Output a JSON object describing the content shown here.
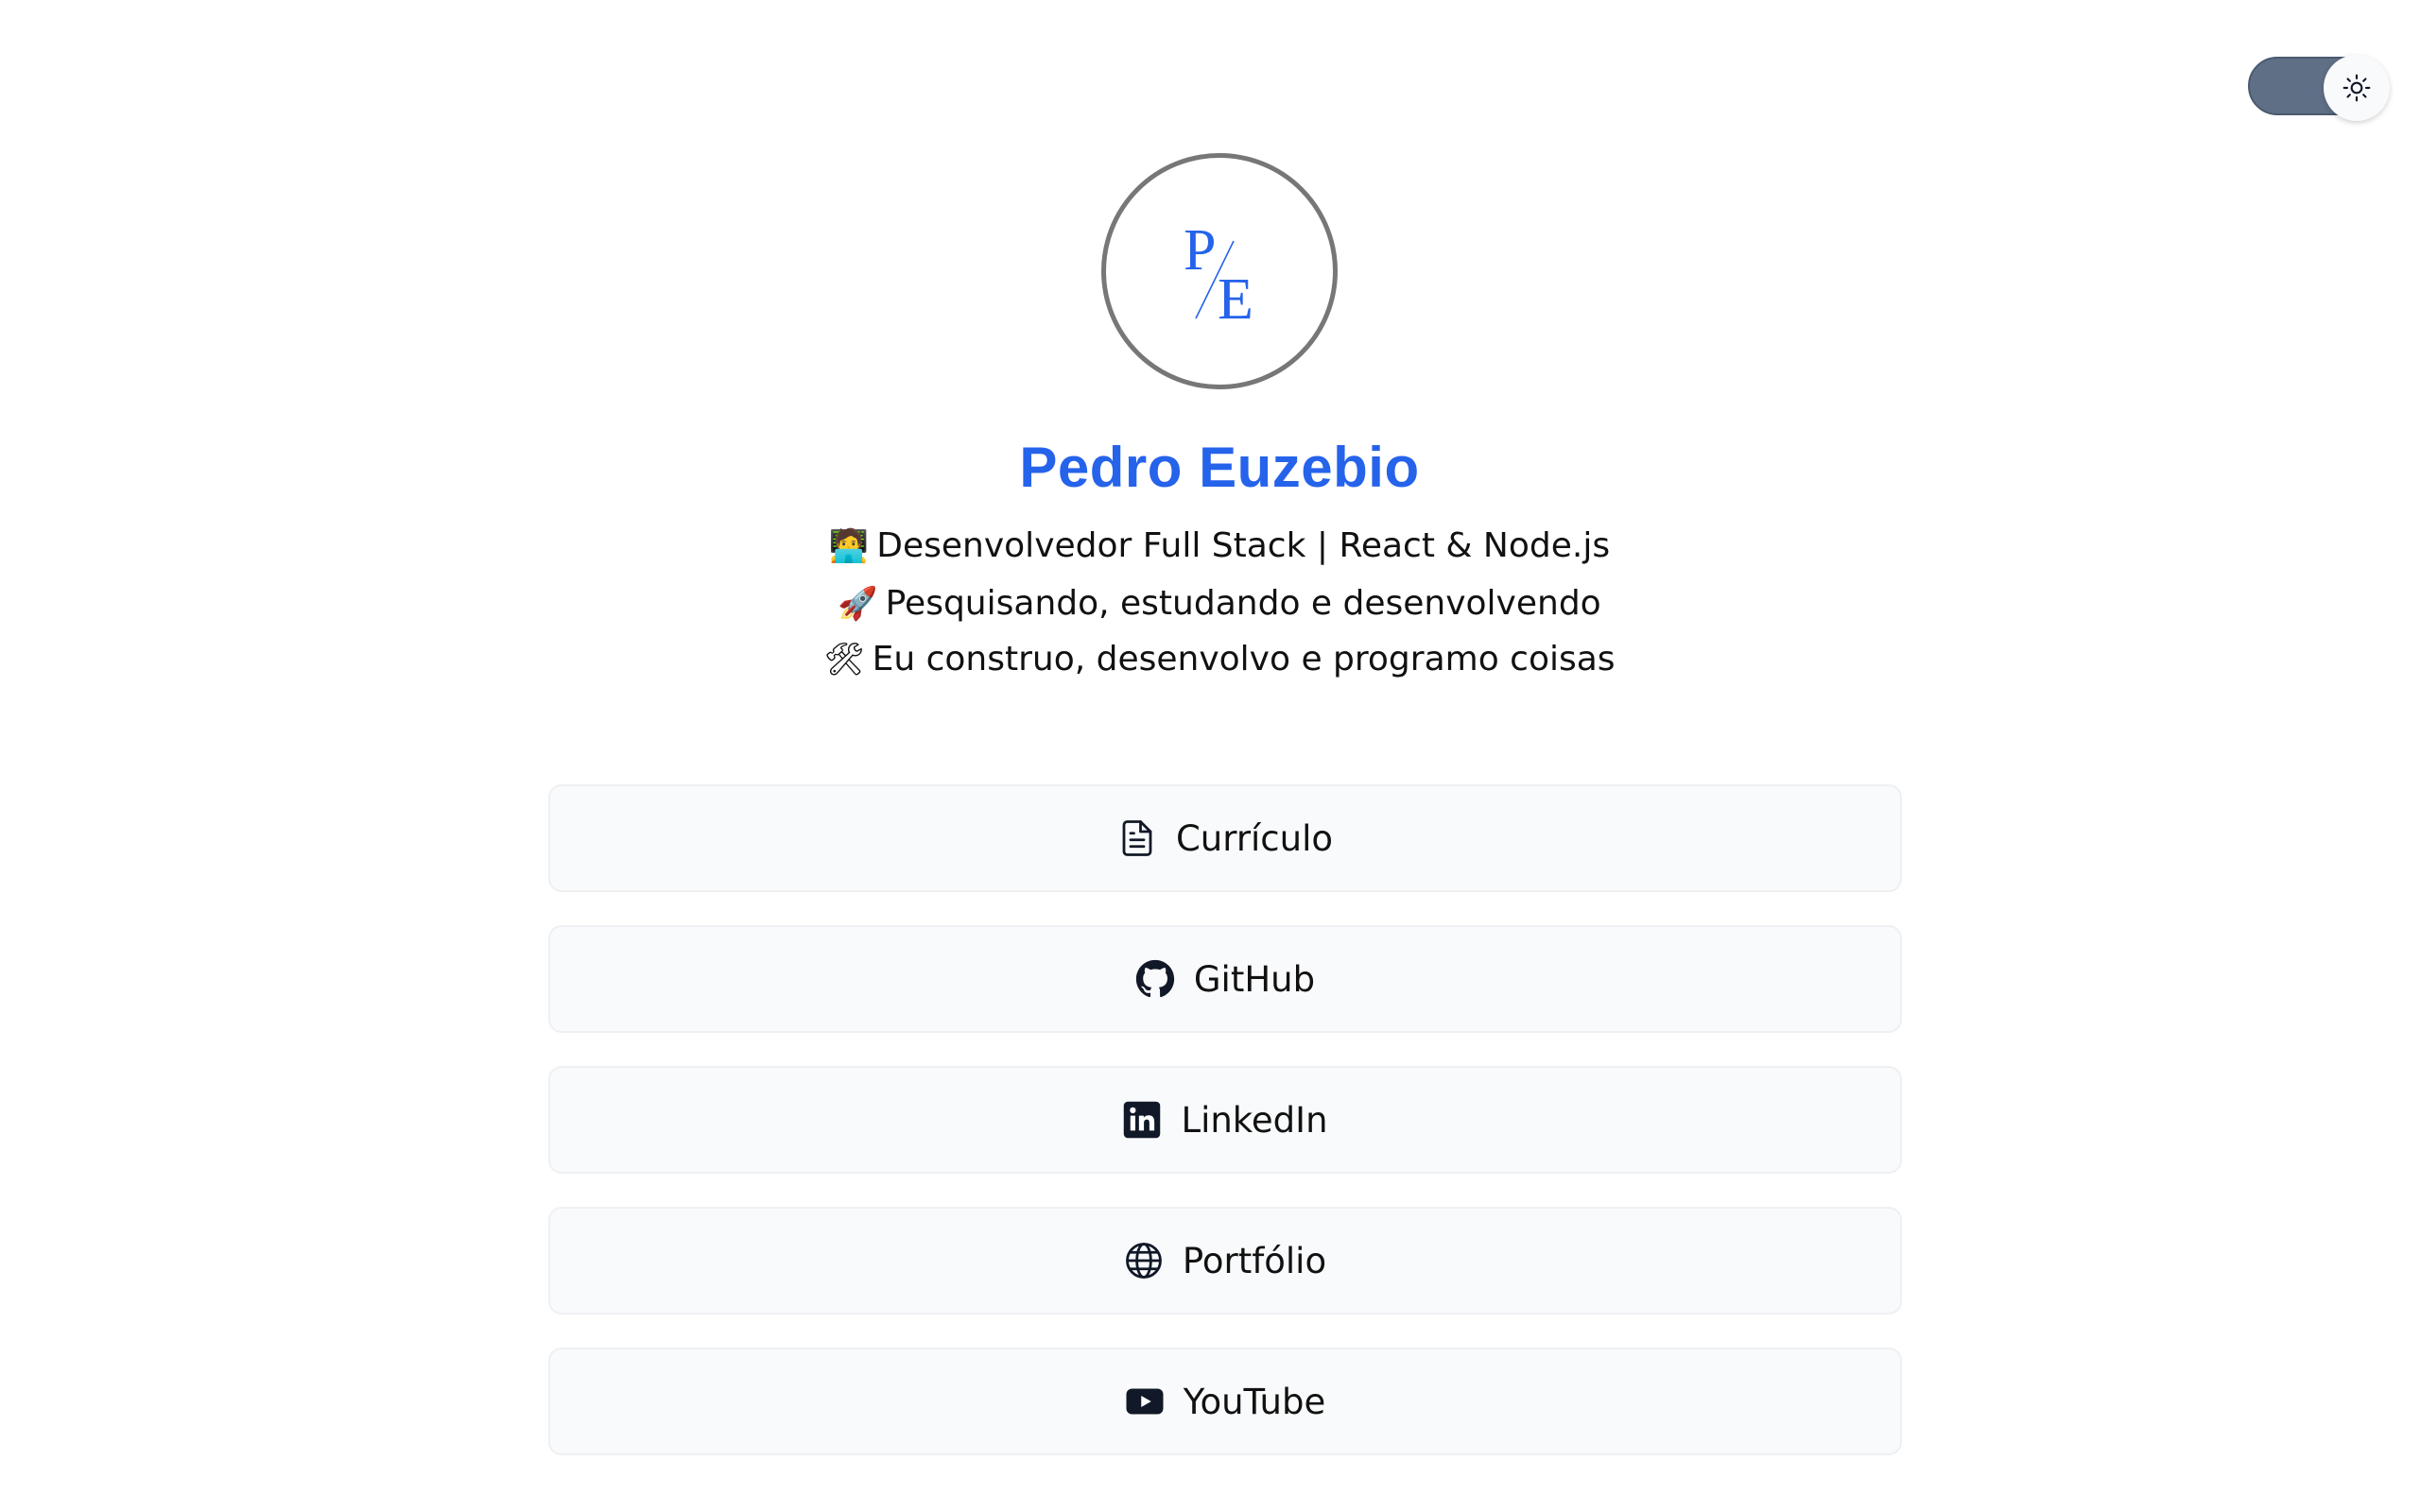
{
  "theme_toggle": {
    "icon": "sun-icon",
    "state": "light"
  },
  "profile": {
    "avatar_monogram": {
      "top": "P",
      "bottom": "E"
    },
    "name": "Pedro Euzebio",
    "bio": [
      {
        "emoji": "🧑‍💻",
        "text": "Desenvolvedor Full Stack | React & Node.js"
      },
      {
        "emoji": "🚀",
        "text": "Pesquisando, estudando e desenvolvendo"
      },
      {
        "emoji": "🛠",
        "text": "Eu construo, desenvolvo e programo coisas"
      }
    ]
  },
  "links": [
    {
      "label": "Currículo",
      "icon": "document-icon"
    },
    {
      "label": "GitHub",
      "icon": "github-icon"
    },
    {
      "label": "LinkedIn",
      "icon": "linkedin-icon"
    },
    {
      "label": "Portfólio",
      "icon": "globe-icon"
    },
    {
      "label": "YouTube",
      "icon": "youtube-icon"
    }
  ],
  "colors": {
    "accent": "#2563eb",
    "button_bg": "#f9fafb",
    "toggle_track": "#5f6f86"
  }
}
